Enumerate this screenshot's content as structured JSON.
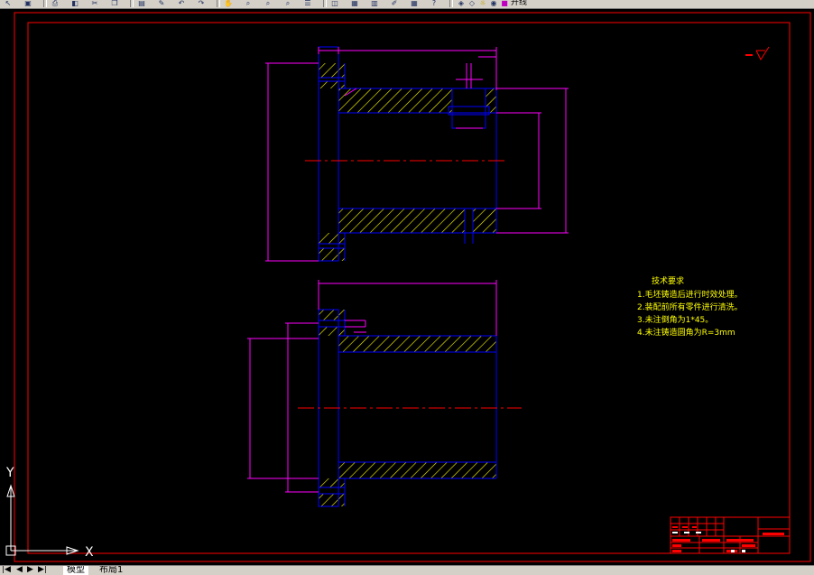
{
  "toolbar": {
    "icons": [
      "select-icon",
      "save-icon",
      "print-icon",
      "preview-icon",
      "cut-icon",
      "copy-icon",
      "paste-icon",
      "match-properties-icon",
      "undo-icon",
      "redo-icon",
      "pan-icon",
      "zoom-realtime-icon",
      "zoom-window-icon",
      "zoom-previous-icon",
      "properties-icon",
      "design-center-icon",
      "tool-palettes-icon",
      "sheet-set-icon",
      "markup-icon",
      "calc-icon",
      "help-icon",
      "layer-manager-icon",
      "layer-state-icon",
      "layer-freeze-icon",
      "layer-lock-icon",
      "layer-color-icon"
    ],
    "layer_name": "开线"
  },
  "drawing": {
    "notes_title": "技术要求",
    "notes": [
      "1.毛坯铸造后进行时效处理。",
      "2.装配前所有零件进行清洗。",
      "3.未注倒角为1*45。",
      "4.未注铸造圆角为R=3mm"
    ],
    "ucs": {
      "y_label": "Y",
      "x_label": "X"
    }
  },
  "tabs": {
    "nav": [
      "|◀",
      "◀",
      "▶",
      "▶|"
    ],
    "items": [
      "模型",
      "布局1"
    ],
    "active_index": 0
  },
  "colors": {
    "background": "#000000",
    "frame": "#ff0000",
    "part_outline": "#0000ff",
    "dimension": "#ff00ff",
    "hatch": "#ffff00",
    "centerline": "#ff0000",
    "text": "#ffff00"
  }
}
